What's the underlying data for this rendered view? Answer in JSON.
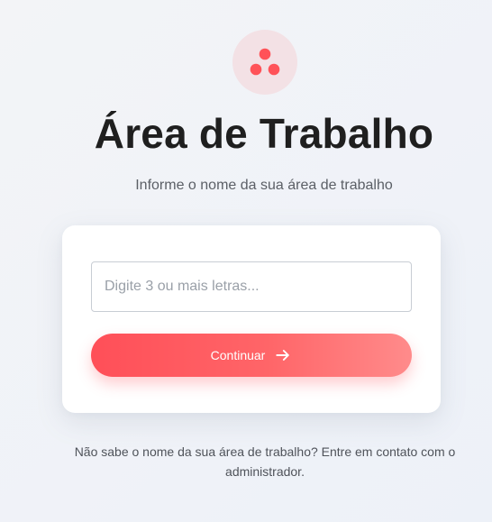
{
  "logo": {
    "icon": "three-dots-logo-icon",
    "accent_color": "#ff5258",
    "bg_color": "#f3e1e5"
  },
  "page": {
    "title": "Área de Trabalho",
    "subtitle": "Informe o nome da sua área de trabalho"
  },
  "form": {
    "input_value": "",
    "input_placeholder": "Digite 3 ou mais letras...",
    "button_label": "Continuar",
    "button_icon": "arrow-right-icon"
  },
  "footer": {
    "note": "Não sabe o nome da sua área de trabalho? Entre em contato com o administrador."
  }
}
